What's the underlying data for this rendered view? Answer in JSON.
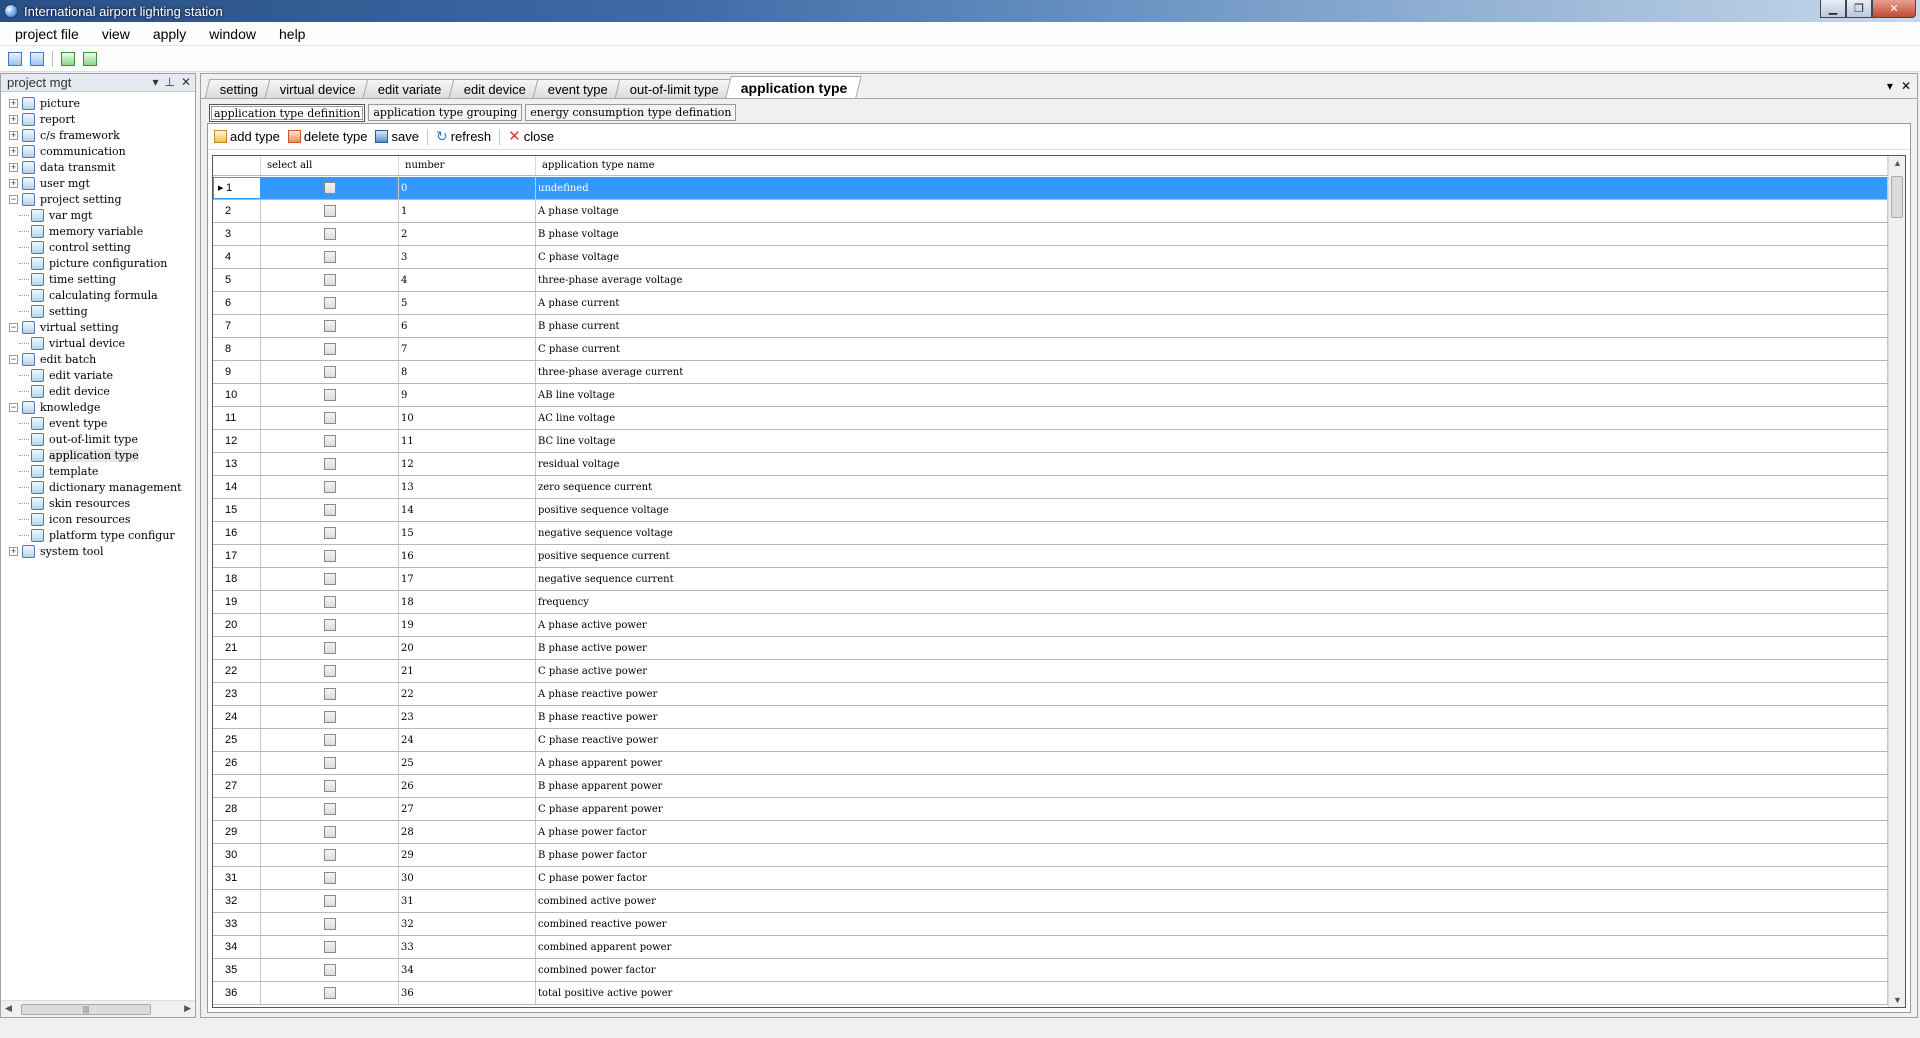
{
  "window": {
    "title": "International airport lighting station"
  },
  "menu": [
    "project file",
    "view",
    "apply",
    "window",
    "help"
  ],
  "left_panel": {
    "title": "project mgt",
    "tree": [
      {
        "label": "picture",
        "level": 0,
        "exp": "+"
      },
      {
        "label": "report",
        "level": 0,
        "exp": "+"
      },
      {
        "label": "c/s framework",
        "level": 0,
        "exp": "+"
      },
      {
        "label": "communication",
        "level": 0,
        "exp": "+"
      },
      {
        "label": "data transmit",
        "level": 0,
        "exp": "+"
      },
      {
        "label": "user mgt",
        "level": 0,
        "exp": "+"
      },
      {
        "label": "project setting",
        "level": 0,
        "exp": "−"
      },
      {
        "label": "var mgt",
        "level": 1
      },
      {
        "label": "memory variable",
        "level": 1
      },
      {
        "label": "control setting",
        "level": 1
      },
      {
        "label": "picture configuration",
        "level": 1
      },
      {
        "label": "time setting",
        "level": 1
      },
      {
        "label": "calculating formula",
        "level": 1
      },
      {
        "label": "setting",
        "level": 1
      },
      {
        "label": "virtual setting",
        "level": 0,
        "exp": "−"
      },
      {
        "label": "virtual device",
        "level": 1
      },
      {
        "label": "edit batch",
        "level": 0,
        "exp": "−"
      },
      {
        "label": "edit variate",
        "level": 1
      },
      {
        "label": "edit device",
        "level": 1
      },
      {
        "label": "knowledge",
        "level": 0,
        "exp": "−"
      },
      {
        "label": "event type",
        "level": 1
      },
      {
        "label": "out-of-limit type",
        "level": 1
      },
      {
        "label": "application type",
        "level": 1,
        "selected": true
      },
      {
        "label": "template",
        "level": 1
      },
      {
        "label": "dictionary management",
        "level": 1
      },
      {
        "label": "skin resources",
        "level": 1
      },
      {
        "label": "icon resources",
        "level": 1
      },
      {
        "label": "platform type configur",
        "level": 1
      },
      {
        "label": "system tool",
        "level": 0,
        "exp": "+"
      }
    ]
  },
  "doc_tabs": [
    {
      "label": "setting"
    },
    {
      "label": "virtual device"
    },
    {
      "label": "edit variate"
    },
    {
      "label": "edit device"
    },
    {
      "label": "event type"
    },
    {
      "label": "out-of-limit type"
    },
    {
      "label": "application type",
      "active": true
    }
  ],
  "sub_tabs": [
    {
      "label": "application type definition",
      "active": true
    },
    {
      "label": "application type grouping"
    },
    {
      "label": "energy consumption type defination"
    }
  ],
  "actions": {
    "add": "add type",
    "delete": "delete type",
    "save": "save",
    "refresh": "refresh",
    "close": "close"
  },
  "grid": {
    "columns": {
      "select_all": "select all",
      "number": "number",
      "name": "application type name"
    },
    "selected_row": 1,
    "rows": [
      {
        "row": "1",
        "number": "0",
        "name": "undefined"
      },
      {
        "row": "2",
        "number": "1",
        "name": "A phase voltage"
      },
      {
        "row": "3",
        "number": "2",
        "name": "B phase voltage"
      },
      {
        "row": "4",
        "number": "3",
        "name": "C phase voltage"
      },
      {
        "row": "5",
        "number": "4",
        "name": "three-phase average voltage"
      },
      {
        "row": "6",
        "number": "5",
        "name": "A phase current"
      },
      {
        "row": "7",
        "number": "6",
        "name": "B phase current"
      },
      {
        "row": "8",
        "number": "7",
        "name": "C phase current"
      },
      {
        "row": "9",
        "number": "8",
        "name": "three-phase average current"
      },
      {
        "row": "10",
        "number": "9",
        "name": "AB line voltage"
      },
      {
        "row": "11",
        "number": "10",
        "name": "AC line voltage"
      },
      {
        "row": "12",
        "number": "11",
        "name": "BC line voltage"
      },
      {
        "row": "13",
        "number": "12",
        "name": "residual voltage"
      },
      {
        "row": "14",
        "number": "13",
        "name": "zero sequence current"
      },
      {
        "row": "15",
        "number": "14",
        "name": "positive sequence voltage"
      },
      {
        "row": "16",
        "number": "15",
        "name": "negative sequence voltage"
      },
      {
        "row": "17",
        "number": "16",
        "name": "positive sequence current"
      },
      {
        "row": "18",
        "number": "17",
        "name": "negative sequence current"
      },
      {
        "row": "19",
        "number": "18",
        "name": "frequency"
      },
      {
        "row": "20",
        "number": "19",
        "name": "A phase active power"
      },
      {
        "row": "21",
        "number": "20",
        "name": "B phase active power"
      },
      {
        "row": "22",
        "number": "21",
        "name": "C phase active power"
      },
      {
        "row": "23",
        "number": "22",
        "name": "A phase reactive power"
      },
      {
        "row": "24",
        "number": "23",
        "name": "B phase reactive power"
      },
      {
        "row": "25",
        "number": "24",
        "name": "C phase reactive power"
      },
      {
        "row": "26",
        "number": "25",
        "name": "A phase apparent power"
      },
      {
        "row": "27",
        "number": "26",
        "name": "B phase apparent power"
      },
      {
        "row": "28",
        "number": "27",
        "name": "C phase apparent power"
      },
      {
        "row": "29",
        "number": "28",
        "name": "A phase power factor"
      },
      {
        "row": "30",
        "number": "29",
        "name": "B phase power factor"
      },
      {
        "row": "31",
        "number": "30",
        "name": "C phase power factor"
      },
      {
        "row": "32",
        "number": "31",
        "name": "combined active power"
      },
      {
        "row": "33",
        "number": "32",
        "name": "combined reactive power"
      },
      {
        "row": "34",
        "number": "33",
        "name": "combined apparent power"
      },
      {
        "row": "35",
        "number": "34",
        "name": "combined power factor"
      },
      {
        "row": "36",
        "number": "36",
        "name": "total positive active power"
      }
    ]
  }
}
